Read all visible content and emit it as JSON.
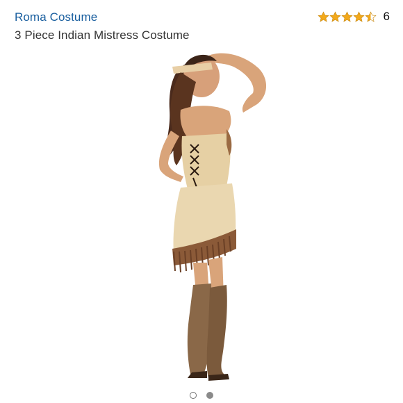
{
  "product": {
    "brand": "Roma Costume",
    "title": "3 Piece Indian Mistress Costume"
  },
  "rating": {
    "stars": 4.5,
    "max": 5,
    "count": "6",
    "star_color": "#f3a91b"
  },
  "gallery": {
    "images_total": 2,
    "current_index": 1
  },
  "colors": {
    "link": "#1a5f9f",
    "text": "#333333"
  }
}
